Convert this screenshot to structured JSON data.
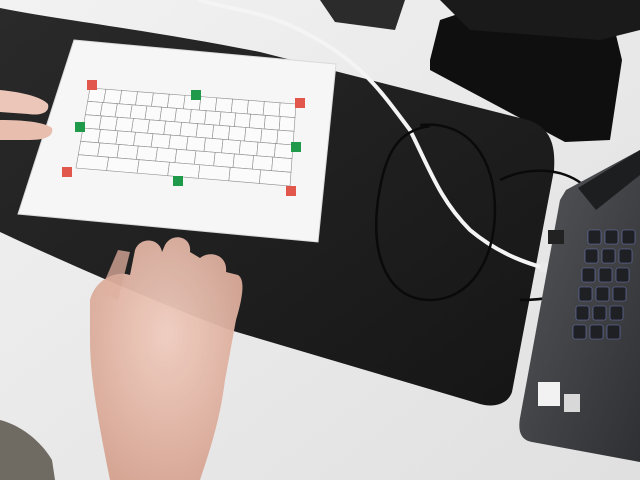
{
  "scene": {
    "description_free": true,
    "colors": {
      "desk": "#ececec",
      "mat": "#1c1c1c",
      "paper": "#f7f7f7",
      "marker_red": "#e2574c",
      "marker_green": "#1f9a4a",
      "cable": "#f2f2f2",
      "laptop": "#3a3b3e",
      "monitor": "#111111",
      "skin": "#e2b6a6"
    }
  },
  "markers": [
    {
      "color": "red"
    },
    {
      "color": "green"
    },
    {
      "color": "red"
    },
    {
      "color": "green"
    },
    {
      "color": "green"
    },
    {
      "color": "red"
    },
    {
      "color": "green"
    },
    {
      "color": "red"
    }
  ],
  "keyboard_rows": [
    13,
    14,
    13,
    12,
    11,
    7
  ]
}
